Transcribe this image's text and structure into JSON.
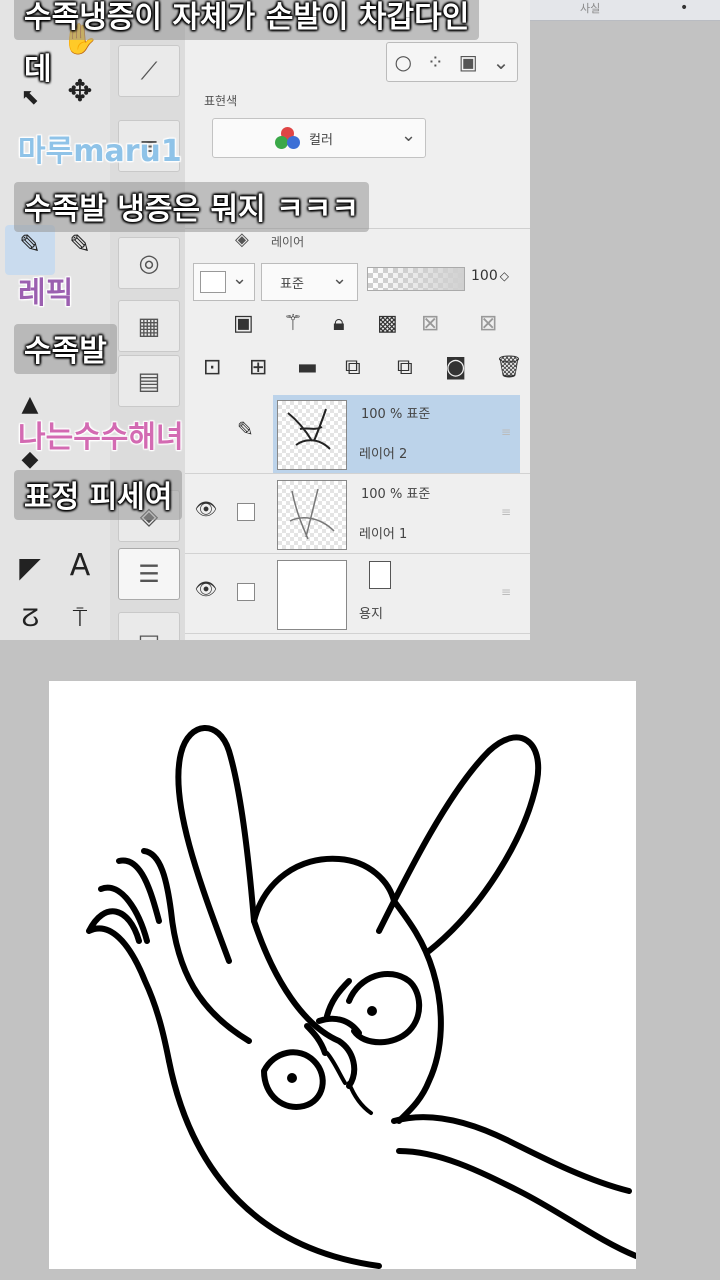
{
  "app": {
    "section_color_label": "표현색",
    "color_mode": "컬러",
    "layer_panel_title": "레이어",
    "blend_mode": "표준",
    "opacity_value": "100",
    "opacity_spinner": "◇",
    "top_right_text": "사실",
    "top_right_dot": "•",
    "layers": [
      {
        "mode": "100 % 표준",
        "name": "레이어 2",
        "selected": true
      },
      {
        "mode": "100 % 표준",
        "name": "레이어 1",
        "selected": false
      },
      {
        "mode": "",
        "name": "용지",
        "selected": false
      }
    ],
    "tools_letter": "A",
    "accent_color": "#bcd3ea"
  },
  "chat": [
    {
      "type": "message",
      "text": "수족냉증이 자체가 손발이 차갑다인"
    },
    {
      "type": "message",
      "text": "데"
    },
    {
      "type": "name",
      "text": "마루maru1",
      "color": "#8fc3e8"
    },
    {
      "type": "message",
      "text": "수족발 냉증은 뭐지 ㅋㅋㅋ"
    },
    {
      "type": "name",
      "text": "레픽",
      "color": "#9b5fb0"
    },
    {
      "type": "message",
      "text": "수족발"
    },
    {
      "type": "name",
      "text": "나는수수해녀",
      "color": "#d36ab2"
    },
    {
      "type": "message",
      "text": "표정 피세여"
    }
  ],
  "icons": {
    "eye": "eye-icon",
    "pencil": "pencil-icon",
    "layers": "layers-icon",
    "trash": "trash-icon",
    "lock": "lock-icon"
  }
}
